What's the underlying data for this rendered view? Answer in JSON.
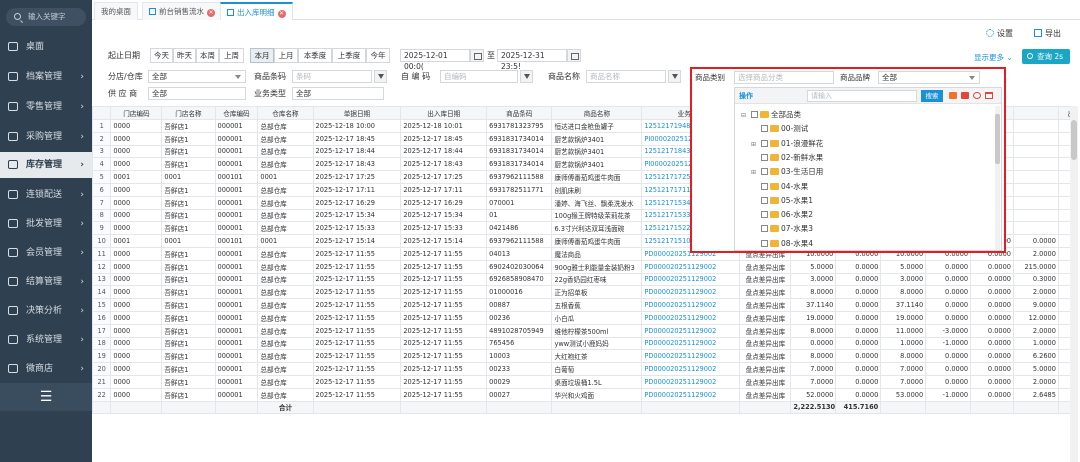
{
  "sidebar": {
    "search_placeholder": "输入关键字",
    "items": [
      {
        "label": "桌面",
        "arrow": "",
        "icon": "monitor-icon"
      },
      {
        "label": "档案管理",
        "arrow": "›",
        "icon": "archive-icon"
      },
      {
        "label": "零售管理",
        "arrow": "›",
        "icon": "retail-icon"
      },
      {
        "label": "采购管理",
        "arrow": "›",
        "icon": "purchase-icon"
      },
      {
        "label": "库存管理",
        "arrow": "›",
        "icon": "inventory-icon"
      },
      {
        "label": "连锁配送",
        "arrow": "›",
        "icon": "delivery-icon"
      },
      {
        "label": "批发管理",
        "arrow": "›",
        "icon": "wholesale-icon"
      },
      {
        "label": "会员管理",
        "arrow": "›",
        "icon": "member-icon"
      },
      {
        "label": "结算管理",
        "arrow": "›",
        "icon": "settlement-icon"
      },
      {
        "label": "决策分析",
        "arrow": "›",
        "icon": "analysis-icon"
      },
      {
        "label": "系统管理",
        "arrow": "›",
        "icon": "system-gear-icon"
      },
      {
        "label": "微商店",
        "arrow": "›",
        "icon": "shop-icon"
      }
    ],
    "collapse": "☰"
  },
  "tabs": [
    {
      "label": "我的桌面"
    },
    {
      "label": "前台销售流水"
    },
    {
      "label": "出入库明细"
    }
  ],
  "toolbar": {
    "settings": "设置",
    "export": "导出"
  },
  "filters": {
    "date_label": "起止日期",
    "quick": [
      "今天",
      "昨天",
      "本周",
      "上周",
      "本月",
      "上月",
      "本季度",
      "上季度",
      "今年"
    ],
    "date_from": "2025-12-01 00:0(",
    "to": "至",
    "date_to": "2025-12-31 23:5!",
    "store_label": "分店/仓库",
    "store_value": "全部",
    "barcode_label": "商品条码",
    "barcode_ph": "条码",
    "code_label": "自 编 码",
    "code_ph": "自编码",
    "name_label": "商品名称",
    "name_ph": "商品名称",
    "supplier_label": "供 应 商",
    "supplier_value": "全部",
    "biztype_label": "业务类型",
    "biztype_value": "全部",
    "category_label": "商品类别",
    "category_ph": "选择商品分类",
    "brand_label": "商品品牌",
    "brand_value": "全部",
    "more": "显示更多 ⌄",
    "query": "查询 2s"
  },
  "popup": {
    "op_label": "操作",
    "search_ph": "请输入",
    "search_btn": "搜索",
    "tree": [
      {
        "toggle": "⊟",
        "label": "全部品类"
      },
      {
        "toggle": "",
        "label": "00-测试"
      },
      {
        "toggle": "⊞",
        "label": "01-浪漫鲜花"
      },
      {
        "toggle": "",
        "label": "02-新鲜水果"
      },
      {
        "toggle": "⊞",
        "label": "03-生活日用"
      },
      {
        "toggle": "",
        "label": "04-水果"
      },
      {
        "toggle": "",
        "label": "05-水果1"
      },
      {
        "toggle": "",
        "label": "06-水果2"
      },
      {
        "toggle": "",
        "label": "07-水果3"
      },
      {
        "toggle": "",
        "label": "08-水果4"
      }
    ]
  },
  "table": {
    "columns": [
      "",
      "门店编码",
      "门店名称",
      "仓库编码",
      "仓库名称",
      "单据日期",
      "出入库日期",
      "商品条码",
      "商品名称",
      "业务单号",
      "",
      "",
      "",
      "",
      "",
      "",
      "",
      "出品单价"
    ],
    "rows": [
      [
        "1",
        "0000",
        "吾鲜店1",
        "000001",
        "总部仓库",
        "2025-12-18 10:00",
        "2025-12-18 10:01",
        "6931781323795",
        "恒达进口金枪鱼罐子",
        "1251217194839903090011",
        "",
        "",
        "",
        "",
        "",
        "",
        "",
        "8.8000"
      ],
      [
        "2",
        "0000",
        "吾鲜店1",
        "000001",
        "总部仓库",
        "2025-12-17 18:45",
        "2025-12-17 18:45",
        "6931831734014",
        "厨艺款锅炉3401",
        "PI000020251217002",
        "",
        "",
        "",
        "",
        "",
        "",
        "",
        "0.0000"
      ],
      [
        "3",
        "0000",
        "吾鲜店1",
        "000001",
        "总部仓库",
        "2025-12-17 18:44",
        "2025-12-17 18:44",
        "6931831734014",
        "厨艺款锅炉3401",
        "1251217184347203090006",
        "",
        "",
        "",
        "",
        "",
        "",
        "",
        "2.5000"
      ],
      [
        "4",
        "0000",
        "吾鲜店1",
        "000001",
        "总部仓库",
        "2025-12-17 18:43",
        "2025-12-17 18:43",
        "6931831734014",
        "厨艺款锅炉3401",
        "PI000020251217001",
        "",
        "",
        "",
        "",
        "",
        "",
        "",
        "0.0000"
      ],
      [
        "5",
        "0001",
        "0001",
        "000101",
        "0001",
        "2025-12-17 17:25",
        "2025-12-17 17:25",
        "6937962111588",
        "康师傅番茄鸡蛋牛肉面",
        "1251217172511001750004",
        "",
        "",
        "",
        "",
        "",
        "",
        "",
        "0.0000"
      ],
      [
        "6",
        "0000",
        "吾鲜店1",
        "000001",
        "总部仓库",
        "2025-12-17 17:11",
        "2025-12-17 17:11",
        "6931782511771",
        "创肌床刷",
        "1251217171103303090005",
        "",
        "",
        "",
        "",
        "",
        "",
        "",
        "6.1600"
      ],
      [
        "7",
        "0000",
        "吾鲜店1",
        "000001",
        "总部仓库",
        "2025-12-17 16:29",
        "2025-12-17 16:29",
        "070001",
        "潘婷、海飞丝、飘柔洗发水",
        "1251217153499400850002",
        "",
        "",
        "",
        "",
        "",
        "",
        "",
        "0.5000"
      ],
      [
        "8",
        "0000",
        "吾鲜店1",
        "000001",
        "总部仓库",
        "2025-12-17 15:34",
        "2025-12-17 15:34",
        "01",
        "100g猴王牌特级茉莉花茶",
        "1251217153335300850001",
        "",
        "",
        "",
        "",
        "",
        "",
        "",
        "16.0000"
      ],
      [
        "9",
        "0000",
        "吾鲜店1",
        "000001",
        "总部仓库",
        "2025-12-17 15:33",
        "2025-12-17 15:33",
        "0421486",
        "6.3寸兴利达双耳浅面碗",
        "1251217152203200850001",
        "",
        "",
        "",
        "",
        "",
        "",
        "",
        "29.0000"
      ],
      [
        "10",
        "0001",
        "0001",
        "000101",
        "0001",
        "2025-12-17 15:14",
        "2025-12-17 15:14",
        "6937962111588",
        "康师傅番茄鸡蛋牛肉面",
        "1251217151021201750001",
        "销售出库",
        "0.0000",
        "0.0000",
        "1.0000",
        "-1.0000",
        "0.0000",
        "0.0000",
        "0.0000"
      ],
      [
        "11",
        "0000",
        "吾鲜店1",
        "000001",
        "总部仓库",
        "2025-12-17 11:55",
        "2025-12-17 11:55",
        "04013",
        "魔法商品",
        "PD000020251129002",
        "盘点差异出库",
        "10.0000",
        "0.0000",
        "10.0000",
        "0.0000",
        "0.0000",
        "2.0000",
        "2.0000"
      ],
      [
        "12",
        "0000",
        "吾鲜店1",
        "000001",
        "总部仓库",
        "2025-12-17 11:55",
        "2025-12-17 11:55",
        "6902402030064",
        "900g雅士利能量金装奶粉3",
        "PD000020251129002",
        "盘点差异出库",
        "5.0000",
        "0.0000",
        "5.0000",
        "0.0000",
        "0.0000",
        "215.0000",
        "215.0000"
      ],
      [
        "13",
        "0000",
        "吾鲜店1",
        "000001",
        "总部仓库",
        "2025-12-17 11:55",
        "2025-12-17 11:55",
        "6926858908470",
        "22g香奶园红枣味",
        "PD000020251129002",
        "盘点差异出库",
        "3.0000",
        "0.0000",
        "3.0000",
        "0.0000",
        "0.0000",
        "0.3000",
        "0.3000"
      ],
      [
        "14",
        "0000",
        "吾鲜店1",
        "000001",
        "总部仓库",
        "2025-12-17 11:55",
        "2025-12-17 11:55",
        "01000016",
        "正为招单板",
        "PD000020251129002",
        "盘点差异出库",
        "8.0000",
        "0.0000",
        "8.0000",
        "0.0000",
        "0.0000",
        "2.0000",
        "2.0000"
      ],
      [
        "15",
        "0000",
        "吾鲜店1",
        "000001",
        "总部仓库",
        "2025-12-17 11:55",
        "2025-12-17 11:55",
        "00887",
        "五根香蕉",
        "PD000020251129002",
        "盘点差异出库",
        "37.1140",
        "0.0000",
        "37.1140",
        "0.0000",
        "0.0000",
        "9.0000",
        "9.0000"
      ],
      [
        "16",
        "0000",
        "吾鲜店1",
        "000001",
        "总部仓库",
        "2025-12-17 11:55",
        "2025-12-17 11:55",
        "00236",
        "小白瓜",
        "PD000020251129002",
        "盘点差异出库",
        "19.0000",
        "0.0000",
        "19.0000",
        "0.0000",
        "0.0000",
        "12.0000",
        "12.0000"
      ],
      [
        "17",
        "0000",
        "吾鲜店1",
        "000001",
        "总部仓库",
        "2025-12-17 11:55",
        "2025-12-17 11:55",
        "4891028705949",
        "维他柠檬茶500ml",
        "PD000020251129002",
        "盘点差异出库",
        "8.0000",
        "0.0000",
        "11.0000",
        "-3.0000",
        "0.0000",
        "2.0000",
        "2.0000"
      ],
      [
        "18",
        "0000",
        "吾鲜店1",
        "000001",
        "总部仓库",
        "2025-12-17 11:55",
        "2025-12-17 11:55",
        "765456",
        "yww测试小鹿妈妈",
        "PD000020251129002",
        "盘点差异出库",
        "0.0000",
        "0.0000",
        "1.0000",
        "-1.0000",
        "0.0000",
        "1.0000",
        "1.0000"
      ],
      [
        "19",
        "0000",
        "吾鲜店1",
        "000001",
        "总部仓库",
        "2025-12-17 11:55",
        "2025-12-17 11:55",
        "10003",
        "大红袍红茶",
        "PD000020251129002",
        "盘点差异出库",
        "8.0000",
        "0.0000",
        "8.0000",
        "0.0000",
        "0.0000",
        "6.2600",
        "6.2600"
      ],
      [
        "20",
        "0000",
        "吾鲜店1",
        "000001",
        "总部仓库",
        "2025-12-17 11:55",
        "2025-12-17 11:55",
        "00233",
        "白葡萄",
        "PD000020251129002",
        "盘点差异出库",
        "7.0000",
        "0.0000",
        "7.0000",
        "0.0000",
        "0.0000",
        "5.0000",
        "5.0000"
      ],
      [
        "21",
        "0000",
        "吾鲜店1",
        "000001",
        "总部仓库",
        "2025-12-17 11:55",
        "2025-12-17 11:55",
        "00029",
        "桌面垃圾桶1.5L",
        "PD000020251129002",
        "盘点差异出库",
        "7.0000",
        "0.0000",
        "7.0000",
        "0.0000",
        "0.0000",
        "2.0000",
        "2.0000"
      ],
      [
        "22",
        "0000",
        "吾鲜店1",
        "000001",
        "总部仓库",
        "2025-12-17 11:55",
        "2025-12-17 11:55",
        "00027",
        "华兴和火鸡面",
        "PD000020251129002",
        "盘点差异出库",
        "52.0000",
        "0.0000",
        "53.0000",
        "-1.0000",
        "0.0000",
        "2.6485",
        "2.6485"
      ]
    ],
    "footer": {
      "label": "合计",
      "total1": "2,222.5130",
      "total2": "415.7160"
    }
  }
}
